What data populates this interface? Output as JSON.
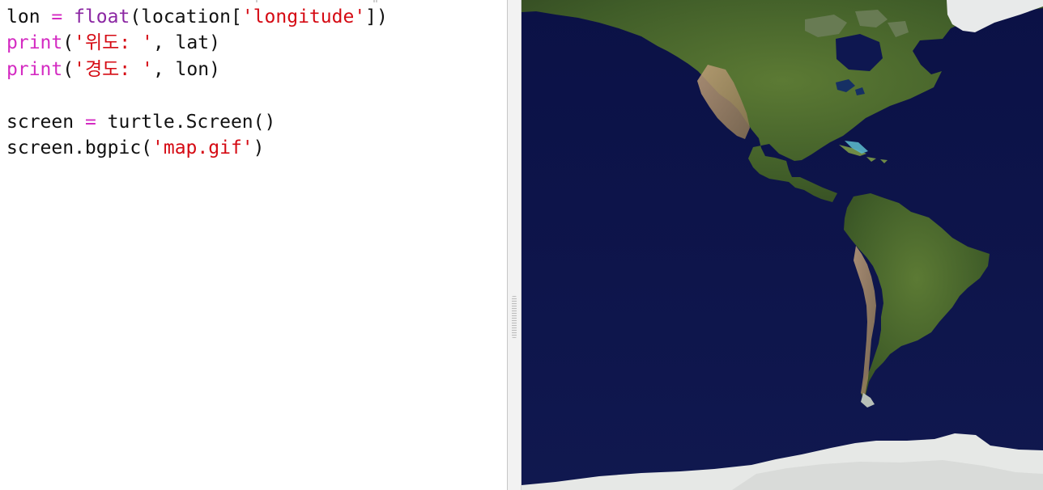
{
  "editor": {
    "lines": [
      [
        {
          "text": "lon ",
          "kind": "default"
        },
        {
          "text": "=",
          "kind": "op"
        },
        {
          "text": " ",
          "kind": "default"
        },
        {
          "text": "float",
          "kind": "builtin"
        },
        {
          "text": "(location[",
          "kind": "default"
        },
        {
          "text": "'longitude'",
          "kind": "string"
        },
        {
          "text": "])",
          "kind": "default"
        }
      ],
      [
        {
          "text": "print",
          "kind": "keyword"
        },
        {
          "text": "(",
          "kind": "default"
        },
        {
          "text": "'위도: '",
          "kind": "string"
        },
        {
          "text": ", lat)",
          "kind": "default"
        }
      ],
      [
        {
          "text": "print",
          "kind": "keyword"
        },
        {
          "text": "(",
          "kind": "default"
        },
        {
          "text": "'경도: '",
          "kind": "string"
        },
        {
          "text": ", lon)",
          "kind": "default"
        }
      ],
      [],
      [
        {
          "text": "screen ",
          "kind": "default"
        },
        {
          "text": "=",
          "kind": "op"
        },
        {
          "text": " turtle.Screen()",
          "kind": "default"
        }
      ],
      [
        {
          "text": "screen.bgpic(",
          "kind": "default"
        },
        {
          "text": "'map.gif'",
          "kind": "string"
        },
        {
          "text": ")",
          "kind": "default"
        }
      ]
    ]
  },
  "map": {
    "ocean_color": "#0b1146",
    "land_color": "#4e6b2d",
    "desert_color": "#b79b72",
    "ice_color": "#e8eaea"
  }
}
